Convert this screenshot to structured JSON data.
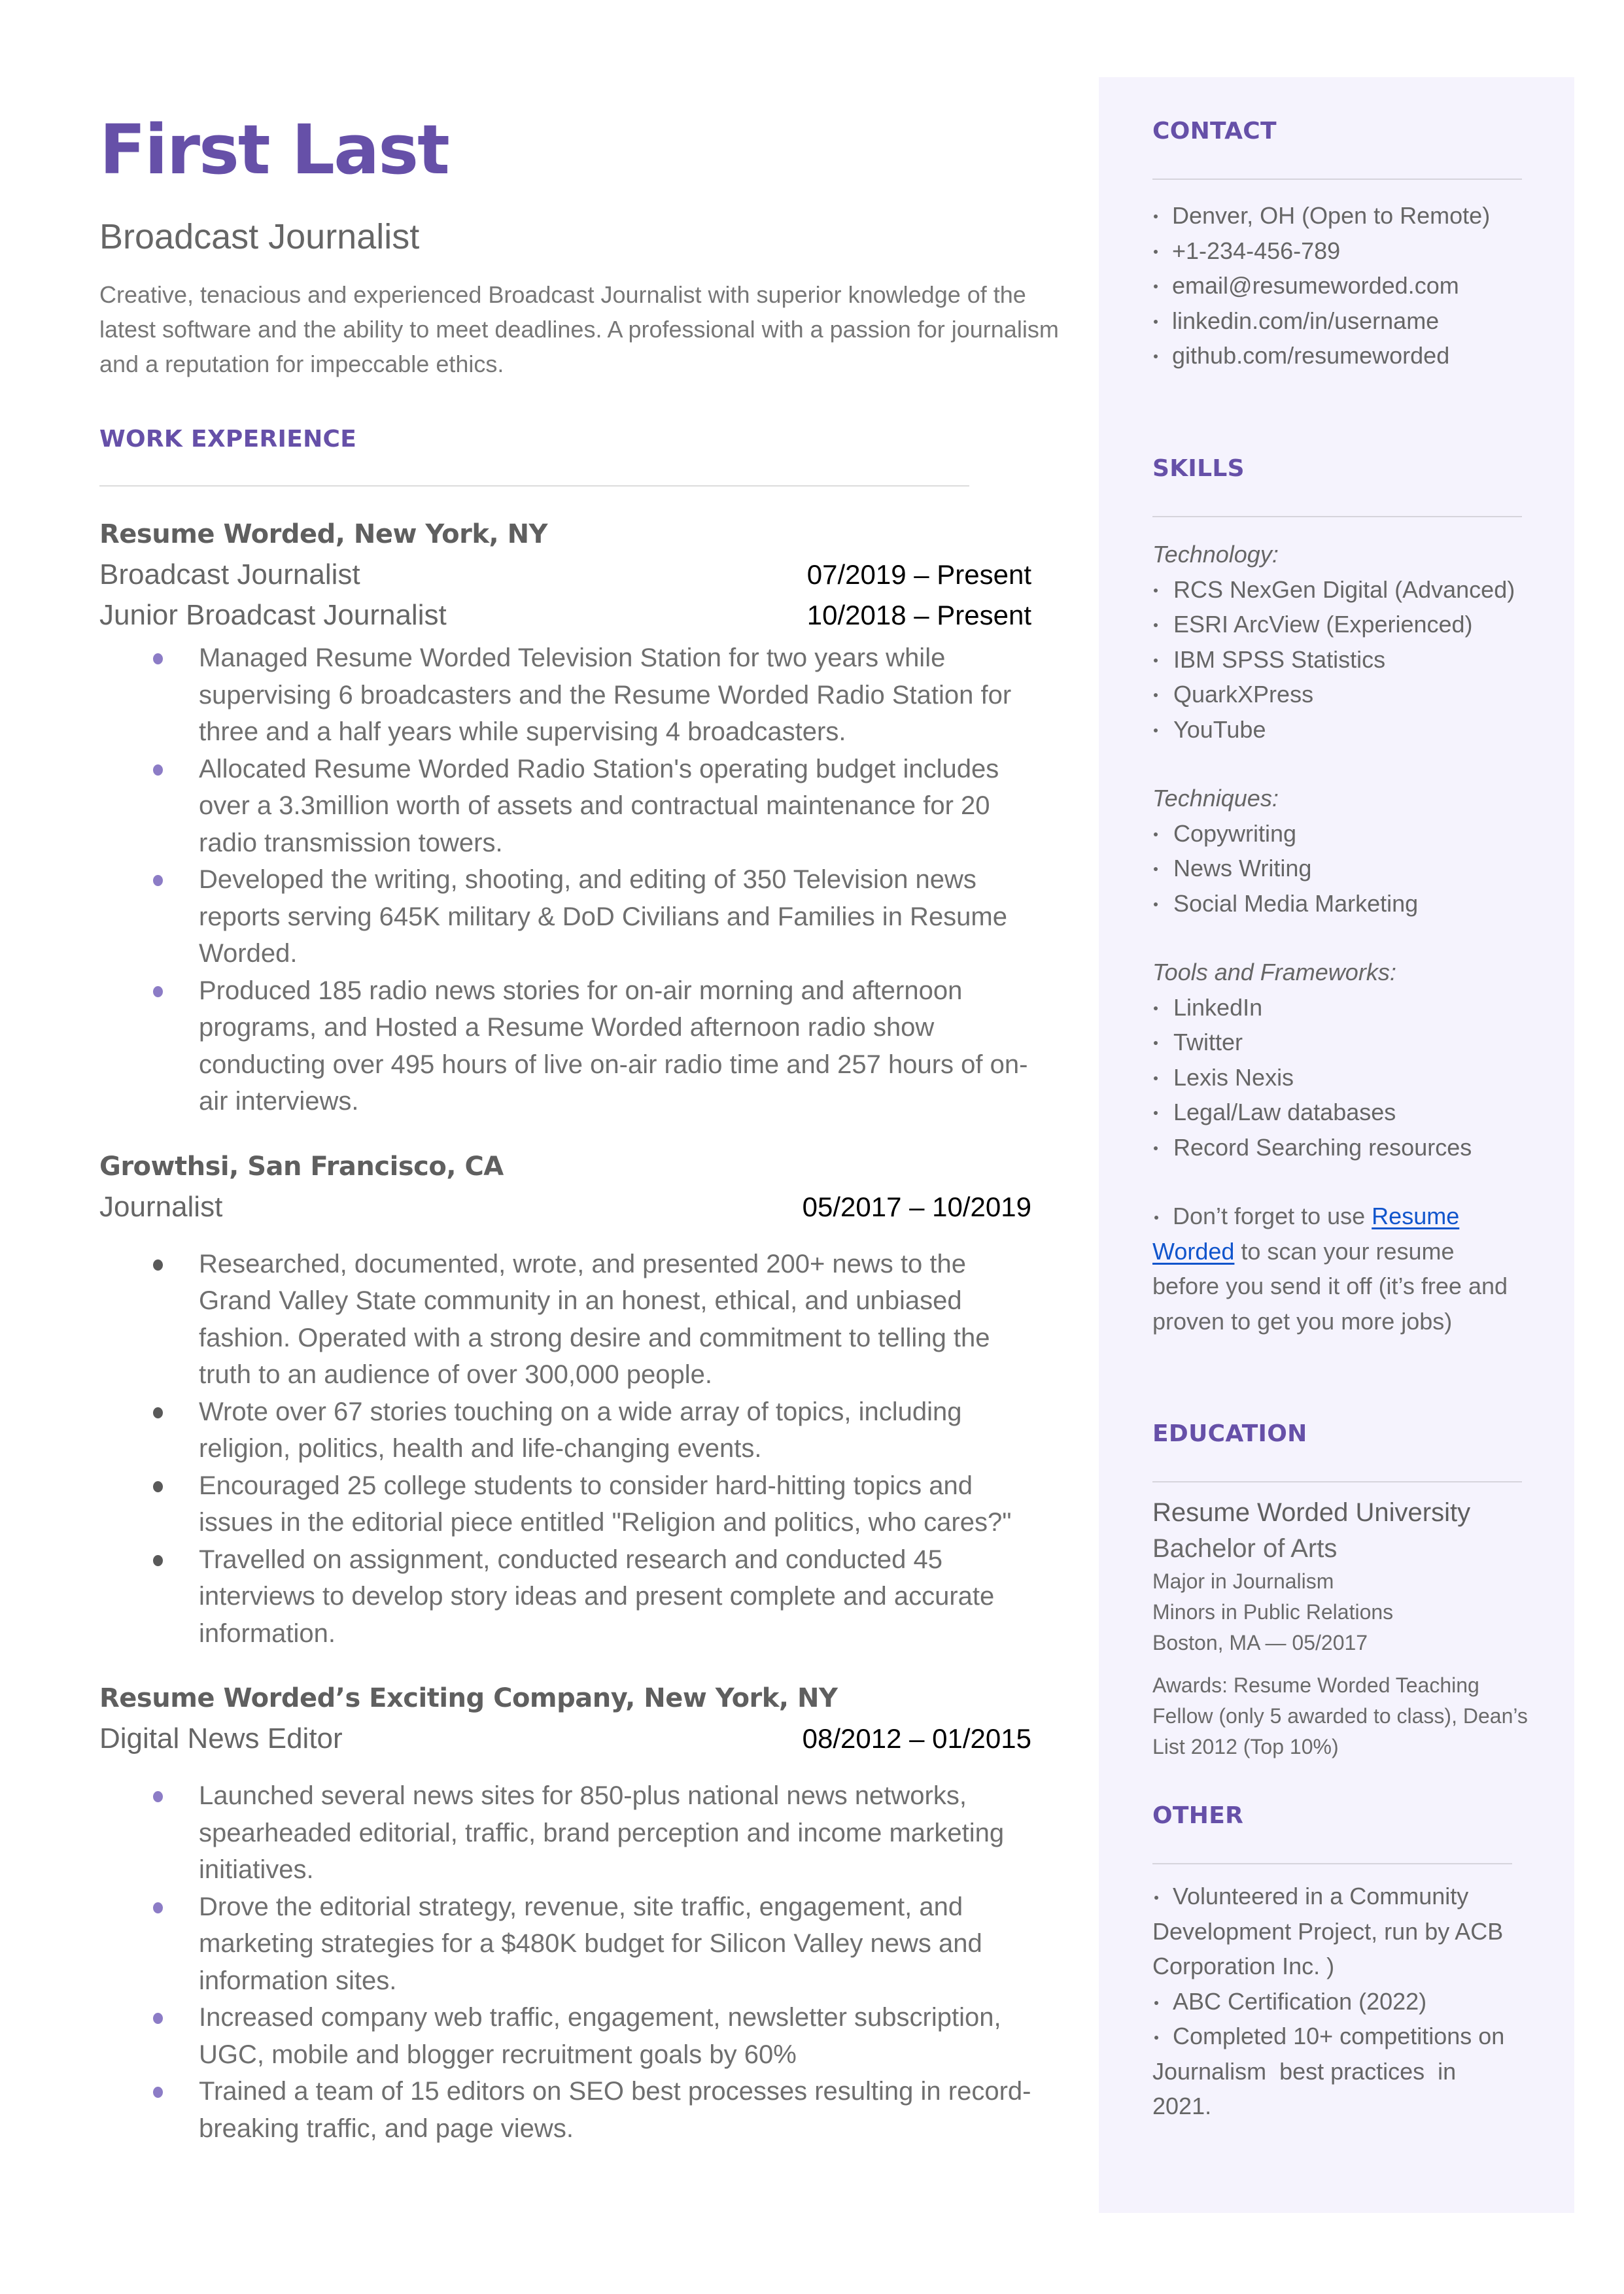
{
  "header": {
    "name": "First Last",
    "title": "Broadcast Journalist",
    "summary": "Creative, tenacious and experienced Broadcast Journalist with superior knowledge of the latest software and the ability to meet deadlines. A professional with a passion for journalism and a reputation for impeccable ethics."
  },
  "work_experience": {
    "heading": "WORK EXPERIENCE",
    "jobs": [
      {
        "company": "Resume Worded, New York, NY",
        "roles": [
          {
            "title": "Broadcast Journalist",
            "dates": "07/2019 – Present"
          },
          {
            "title": "Junior Broadcast Journalist",
            "dates": "10/2018 – Present"
          }
        ],
        "bullets": [
          "Managed Resume Worded Television Station for two years while supervising 6 broadcasters and the Resume Worded Radio Station for three and a half years while supervising 4 broadcasters.",
          "Allocated Resume Worded Radio Station's operating budget includes over a 3.3million worth of assets and contractual maintenance for 20 radio transmission towers.",
          "Developed the writing, shooting, and editing of 350 Television news reports serving 645K military & DoD Civilians and Families in Resume Worded.",
          "Produced 185 radio news stories for on-air morning and afternoon programs, and Hosted a Resume Worded afternoon radio show conducting over 495 hours of live on-air radio time and 257 hours of on-air interviews."
        ]
      },
      {
        "company": "Growthsi, San Francisco, CA",
        "roles": [
          {
            "title": "Journalist",
            "dates": "05/2017 – 10/2019"
          }
        ],
        "bullets": [
          "Researched, documented, wrote, and presented 200+ news to the Grand Valley State community in an honest, ethical, and unbiased fashion. Operated with a strong desire and commitment to telling the truth to an audience of over 300,000 people.",
          "Wrote over 67 stories touching on a wide array of topics, including religion, politics, health and life-changing events.",
          "Encouraged 25 college students to consider hard-hitting topics and issues in the editorial piece entitled \"Religion and politics, who cares?\"",
          "Travelled on assignment, conducted research and conducted 45 interviews to develop story ideas and present complete and accurate information."
        ]
      },
      {
        "company": "Resume Worded’s Exciting Company, New York, NY",
        "roles": [
          {
            "title": "Digital News Editor",
            "dates": "08/2012 – 01/2015"
          }
        ],
        "bullets": [
          "Launched several news sites for 850-plus national news networks, spearheaded editorial, traffic, brand perception and income marketing initiatives.",
          "Drove the editorial strategy, revenue, site traffic, engagement, and marketing strategies for a $480K budget for Silicon Valley news and information sites.",
          "Increased company web traffic, engagement, newsletter subscription, UGC, mobile and blogger recruitment goals by 60%",
          "Trained a team of 15 editors on SEO best processes resulting in record-breaking traffic, and page views."
        ]
      }
    ]
  },
  "contact": {
    "heading": "CONTACT",
    "items": [
      " Denver, OH (Open to Remote)",
      "+1-234-456-789",
      "email@resumeworded.com",
      "linkedin.com/in/username",
      "github.com/resumeworded"
    ]
  },
  "skills": {
    "heading": "SKILLS",
    "categories": [
      {
        "label": "Technology:",
        "items": [
          "RCS NexGen Digital (Advanced)",
          "ESRI ArcView (Experienced)",
          "IBM SPSS Statistics",
          "QuarkXPress",
          "YouTube"
        ]
      },
      {
        "label": "Techniques:",
        "items": [
          "Copywriting",
          "News Writing",
          "Social Media Marketing"
        ]
      },
      {
        "label": "Tools and Frameworks:",
        "items": [
          "LinkedIn",
          "Twitter",
          "Lexis Nexis",
          "Legal/Law databases",
          "Record Searching resources"
        ]
      }
    ],
    "note": {
      "before": "Don’t forget to use ",
      "link_text": "Resume Worded",
      "after": " to scan your resume before you send it off (it’s free and proven to get you more jobs)"
    }
  },
  "education": {
    "heading": "EDUCATION",
    "school": "Resume Worded University",
    "degree": "Bachelor of Arts",
    "major": "Major in Journalism",
    "minor": "Minors in Public Relations",
    "location_date": "Boston, MA — 05/2017",
    "awards": "Awards: Resume Worded Teaching Fellow (only 5 awarded to class), Dean’s List 2012 (Top 10%)"
  },
  "other": {
    "heading": "OTHER",
    "items": [
      "Volunteered in a Community Development Project, run by ACB Corporation Inc. )",
      "ABC Certification (2022)",
      "Completed 10+ competitions on Journalism  best practices  in 2021."
    ]
  },
  "colors": {
    "accent": "#6650a8",
    "sidebar_bg": "#f5f3fd",
    "bullet_purple": "#8c7cc6",
    "link": "#1155cc"
  }
}
